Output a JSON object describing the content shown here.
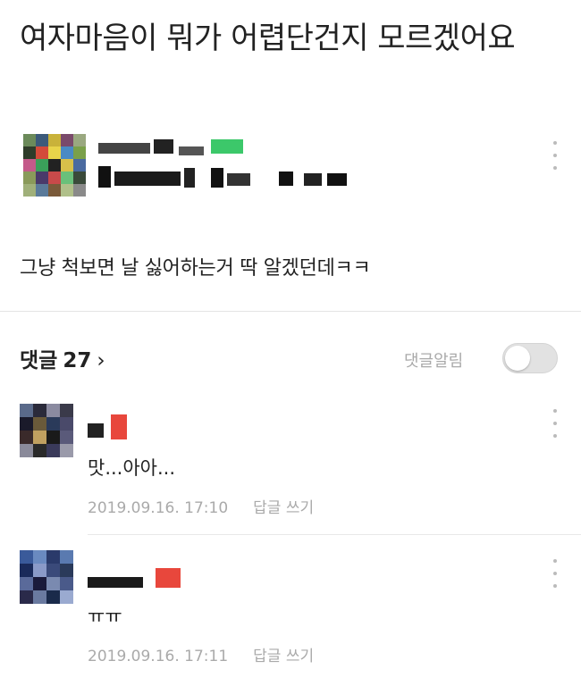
{
  "post": {
    "title": "여자마음이 뭐가 어렵단건지 모르겠어요",
    "body": "그냥 척보면 날 싫어하는거 딱 알겠던데ㅋㅋ"
  },
  "comments_section": {
    "label": "댓글",
    "count": "27",
    "chevron": "›",
    "alarm_label": "댓글알림",
    "alarm_on": false
  },
  "comments": [
    {
      "text": "맛...아아...",
      "timestamp": "2019.09.16. 17:10",
      "reply_label": "답글 쓰기"
    },
    {
      "text": "ㅠㅠ",
      "timestamp": "2019.09.16. 17:11",
      "reply_label": "답글 쓰기"
    }
  ],
  "icons": {
    "more": "more-vertical-icon",
    "chevron": "chevron-right-icon"
  },
  "colors": {
    "text": "#222222",
    "muted": "#aaaaaa",
    "divider": "#e4e4e4",
    "toggle_off": "#e2e2e2",
    "censor_red": "#e8473c",
    "censor_green": "#3cc86a"
  }
}
